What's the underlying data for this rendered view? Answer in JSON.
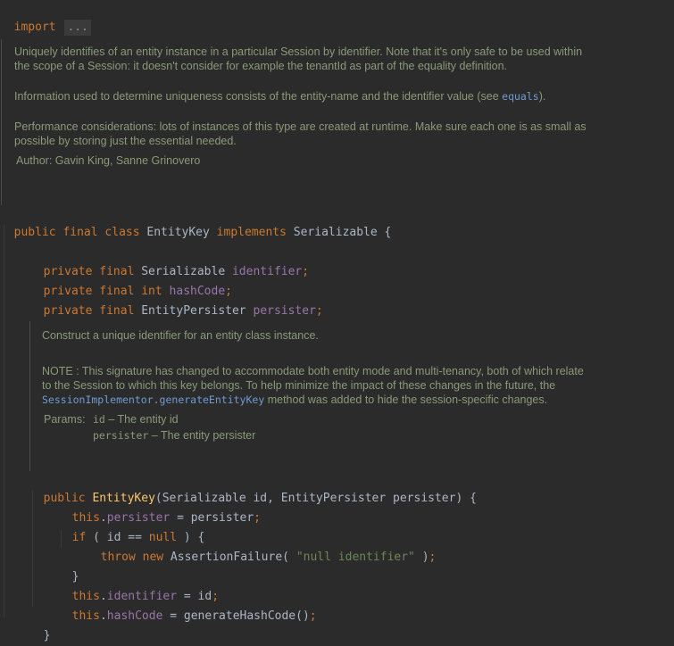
{
  "editor": {
    "import_kw": "import",
    "import_fold": "...",
    "class_doc": {
      "p1": "Uniquely identifies of an entity instance in a particular Session by identifier. Note that it's only safe to be used within the scope of a Session: it doesn't consider for example the tenantId as part of the equality definition.",
      "p2_text": "Information used to determine uniqueness consists of the entity-name and the identifier value (see ",
      "p2_link": "equals",
      "p2_end": ").",
      "p3": "Performance considerations: lots of instances of this type are created at runtime. Make sure each one is as small as possible by storing just the essential needed.",
      "author_label": "Author:",
      "author_value": "Gavin King, Sanne Grinovero"
    },
    "class_decl": {
      "kw1": "public",
      "kw2": "final",
      "kw3": "class",
      "name": "EntityKey",
      "kw4": "implements",
      "iface": "Serializable",
      "brace": "{"
    },
    "fields": [
      {
        "mods": "private final",
        "type": "Serializable",
        "name": "identifier"
      },
      {
        "mods": "private final",
        "type": "int",
        "name": "hashCode"
      },
      {
        "mods": "private final",
        "type": "EntityPersister",
        "name": "persister"
      }
    ],
    "ctor_doc": {
      "p1": "Construct a unique identifier for an entity class instance.",
      "p2_a": "NOTE : This signature has changed to accommodate both entity mode and multi-tenancy, both of which relate to the Session to which this key belongs. To help minimize the impact of these changes in the future, the ",
      "p2_link": "SessionImplementor.generateEntityKey",
      "p2_b": " method was added to hide the session-specific changes.",
      "params_label": "Params:",
      "param1_name": "id",
      "param1_desc": " – The entity id",
      "param2_name": "persister",
      "param2_desc": " – The entity persister"
    },
    "ctor": {
      "kw": "public",
      "name": "EntityKey",
      "params": "(Serializable id, EntityPersister persister) {",
      "line1_this": "this",
      "line1_field": "persister",
      "line1_rest": " = persister",
      "if_kw": "if",
      "if_cond_a": " ( id == ",
      "if_null": "null",
      "if_cond_b": " ) {",
      "throw_kw": "throw",
      "new_kw": "new",
      "throw_type": " AssertionFailure( ",
      "throw_str": "\"null identifier\"",
      "throw_end": " )",
      "close_if": "}",
      "line2_this": "this",
      "line2_field": "identifier",
      "line2_rest": " = id",
      "line3_this": "this",
      "line3_field": "hashCode",
      "line3_rest": " = generateHashCode()",
      "close": "}"
    }
  }
}
